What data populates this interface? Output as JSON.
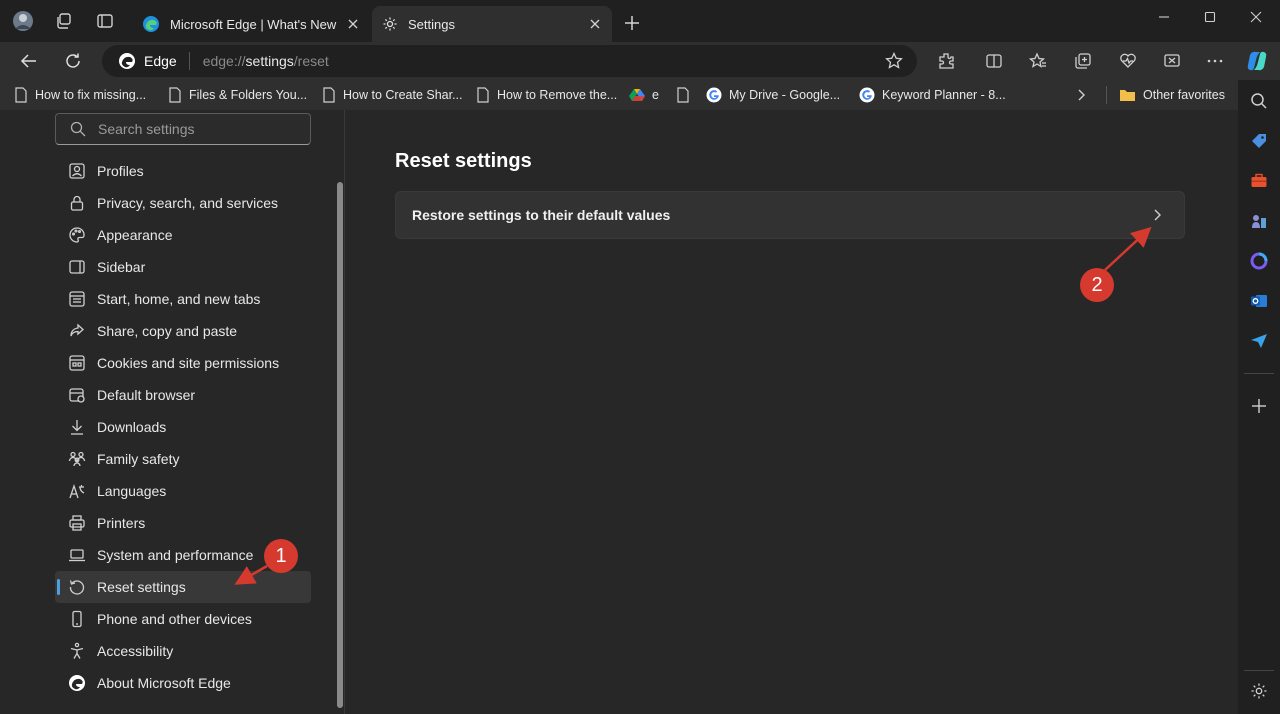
{
  "window": {
    "tabs": [
      {
        "title": "Microsoft Edge | What's New",
        "icon": "edge-logo-icon",
        "active": false
      },
      {
        "title": "Settings",
        "icon": "gear-icon",
        "active": true
      }
    ],
    "controls": [
      "minimize",
      "maximize",
      "close"
    ]
  },
  "toolbar": {
    "address": {
      "badge": "Edge",
      "url_scheme": "edge://",
      "url_page": "settings",
      "url_rest": "/reset"
    }
  },
  "bookmarks": {
    "items": [
      {
        "label": "How to fix missing...",
        "icon": "page-icon"
      },
      {
        "label": "Files & Folders You...",
        "icon": "page-icon"
      },
      {
        "label": "How to Create Shar...",
        "icon": "page-icon"
      },
      {
        "label": "How to Remove the...",
        "icon": "page-icon"
      },
      {
        "label": "e",
        "icon": "google-drive-icon"
      },
      {
        "label": "",
        "icon": "page-icon"
      },
      {
        "label": "My Drive - Google...",
        "icon": "google-icon"
      },
      {
        "label": "Keyword Planner - 8...",
        "icon": "google-icon"
      }
    ],
    "other_favorites": "Other favorites"
  },
  "settings_nav": {
    "search_placeholder": "Search settings",
    "items": [
      {
        "label": "Profiles",
        "icon": "profile-icon"
      },
      {
        "label": "Privacy, search, and services",
        "icon": "lock-icon"
      },
      {
        "label": "Appearance",
        "icon": "palette-icon"
      },
      {
        "label": "Sidebar",
        "icon": "sidebar-icon"
      },
      {
        "label": "Start, home, and new tabs",
        "icon": "home-tabs-icon"
      },
      {
        "label": "Share, copy and paste",
        "icon": "share-icon"
      },
      {
        "label": "Cookies and site permissions",
        "icon": "cookie-icon"
      },
      {
        "label": "Default browser",
        "icon": "browser-icon"
      },
      {
        "label": "Downloads",
        "icon": "download-icon"
      },
      {
        "label": "Family safety",
        "icon": "family-icon"
      },
      {
        "label": "Languages",
        "icon": "language-icon"
      },
      {
        "label": "Printers",
        "icon": "printer-icon"
      },
      {
        "label": "System and performance",
        "icon": "laptop-icon"
      },
      {
        "label": "Reset settings",
        "icon": "reset-icon"
      },
      {
        "label": "Phone and other devices",
        "icon": "phone-icon"
      },
      {
        "label": "Accessibility",
        "icon": "accessibility-icon"
      },
      {
        "label": "About Microsoft Edge",
        "icon": "edge-logo-icon"
      }
    ],
    "selected": "Reset settings"
  },
  "main": {
    "title": "Reset settings",
    "card_label": "Restore settings to their default values"
  },
  "annotations": {
    "step1": "1",
    "step2": "2",
    "color": "#d63a2f"
  },
  "colors": {
    "accent": "#4ca0e0",
    "background": "#272727",
    "chrome": "#202020"
  }
}
